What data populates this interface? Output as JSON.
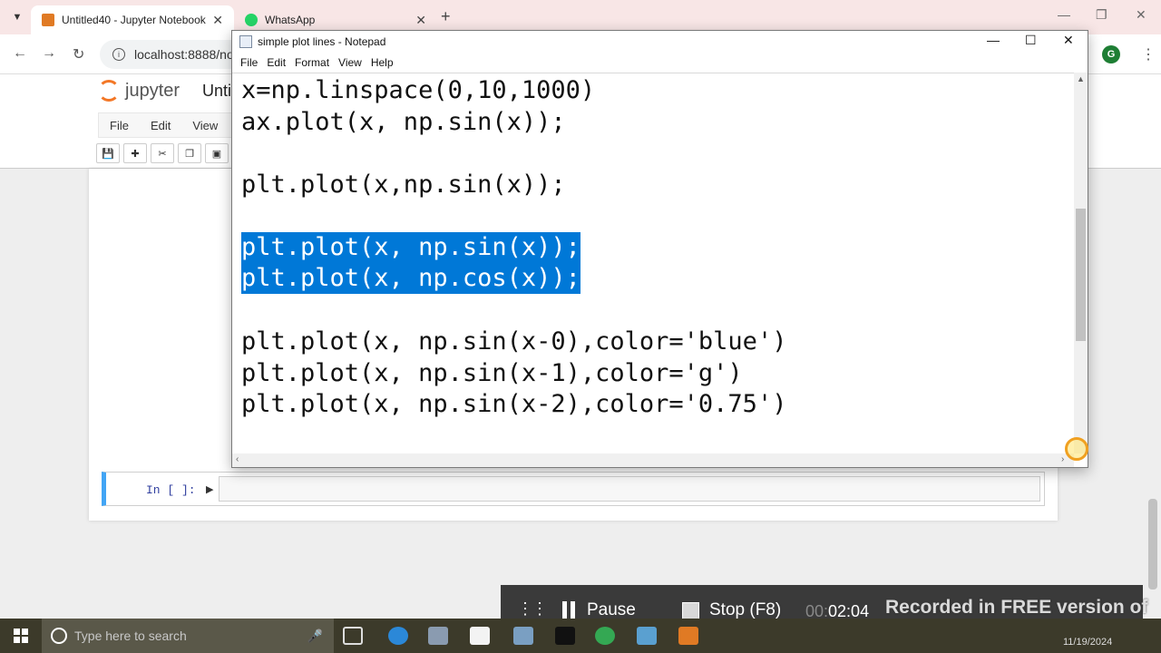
{
  "browser": {
    "tabs": [
      {
        "title": "Untitled40 - Jupyter Notebook",
        "active": true
      },
      {
        "title": "WhatsApp",
        "active": false
      }
    ],
    "url": "localhost:8888/not",
    "profile_letter": "G"
  },
  "jupyter": {
    "logo_text": "jupyter",
    "notebook_title": "Unti",
    "menu": [
      "File",
      "Edit",
      "View"
    ],
    "cell_prompt": "In [ ]:"
  },
  "notepad": {
    "title": "simple plot lines - Notepad",
    "menu": [
      "File",
      "Edit",
      "Format",
      "View",
      "Help"
    ],
    "lines": [
      {
        "text": "x=np.linspace(0,10,1000)",
        "selected": false
      },
      {
        "text": "ax.plot(x, np.sin(x));",
        "selected": false
      },
      {
        "text": "plt.plot(x,np.sin(x));",
        "selected": false
      },
      {
        "text": "plt.plot(x, np.sin(x));",
        "selected": true
      },
      {
        "text": "plt.plot(x, np.cos(x));",
        "selected": true
      },
      {
        "text": "plt.plot(x, np.sin(x-0),color='blue')",
        "selected": false
      },
      {
        "text": "plt.plot(x, np.sin(x-1),color='g')",
        "selected": false
      },
      {
        "text": "plt.plot(x, np.sin(x-2),color='0.75')",
        "selected": false
      }
    ]
  },
  "recorder": {
    "pause_label": "Pause",
    "stop_label": "Stop",
    "stop_shortcut": "(F8)",
    "time": "02:04",
    "watermark": "Recorded in FREE version of Icecream Screen Recorder"
  },
  "taskbar": {
    "search_placeholder": "Type here to search",
    "date": "11/19/2024"
  },
  "colors": {
    "selection": "#0078d7",
    "tab_bar": "#f8e6e6",
    "cell_border": "#42a5f5",
    "jupyter_orange": "#f37726"
  }
}
